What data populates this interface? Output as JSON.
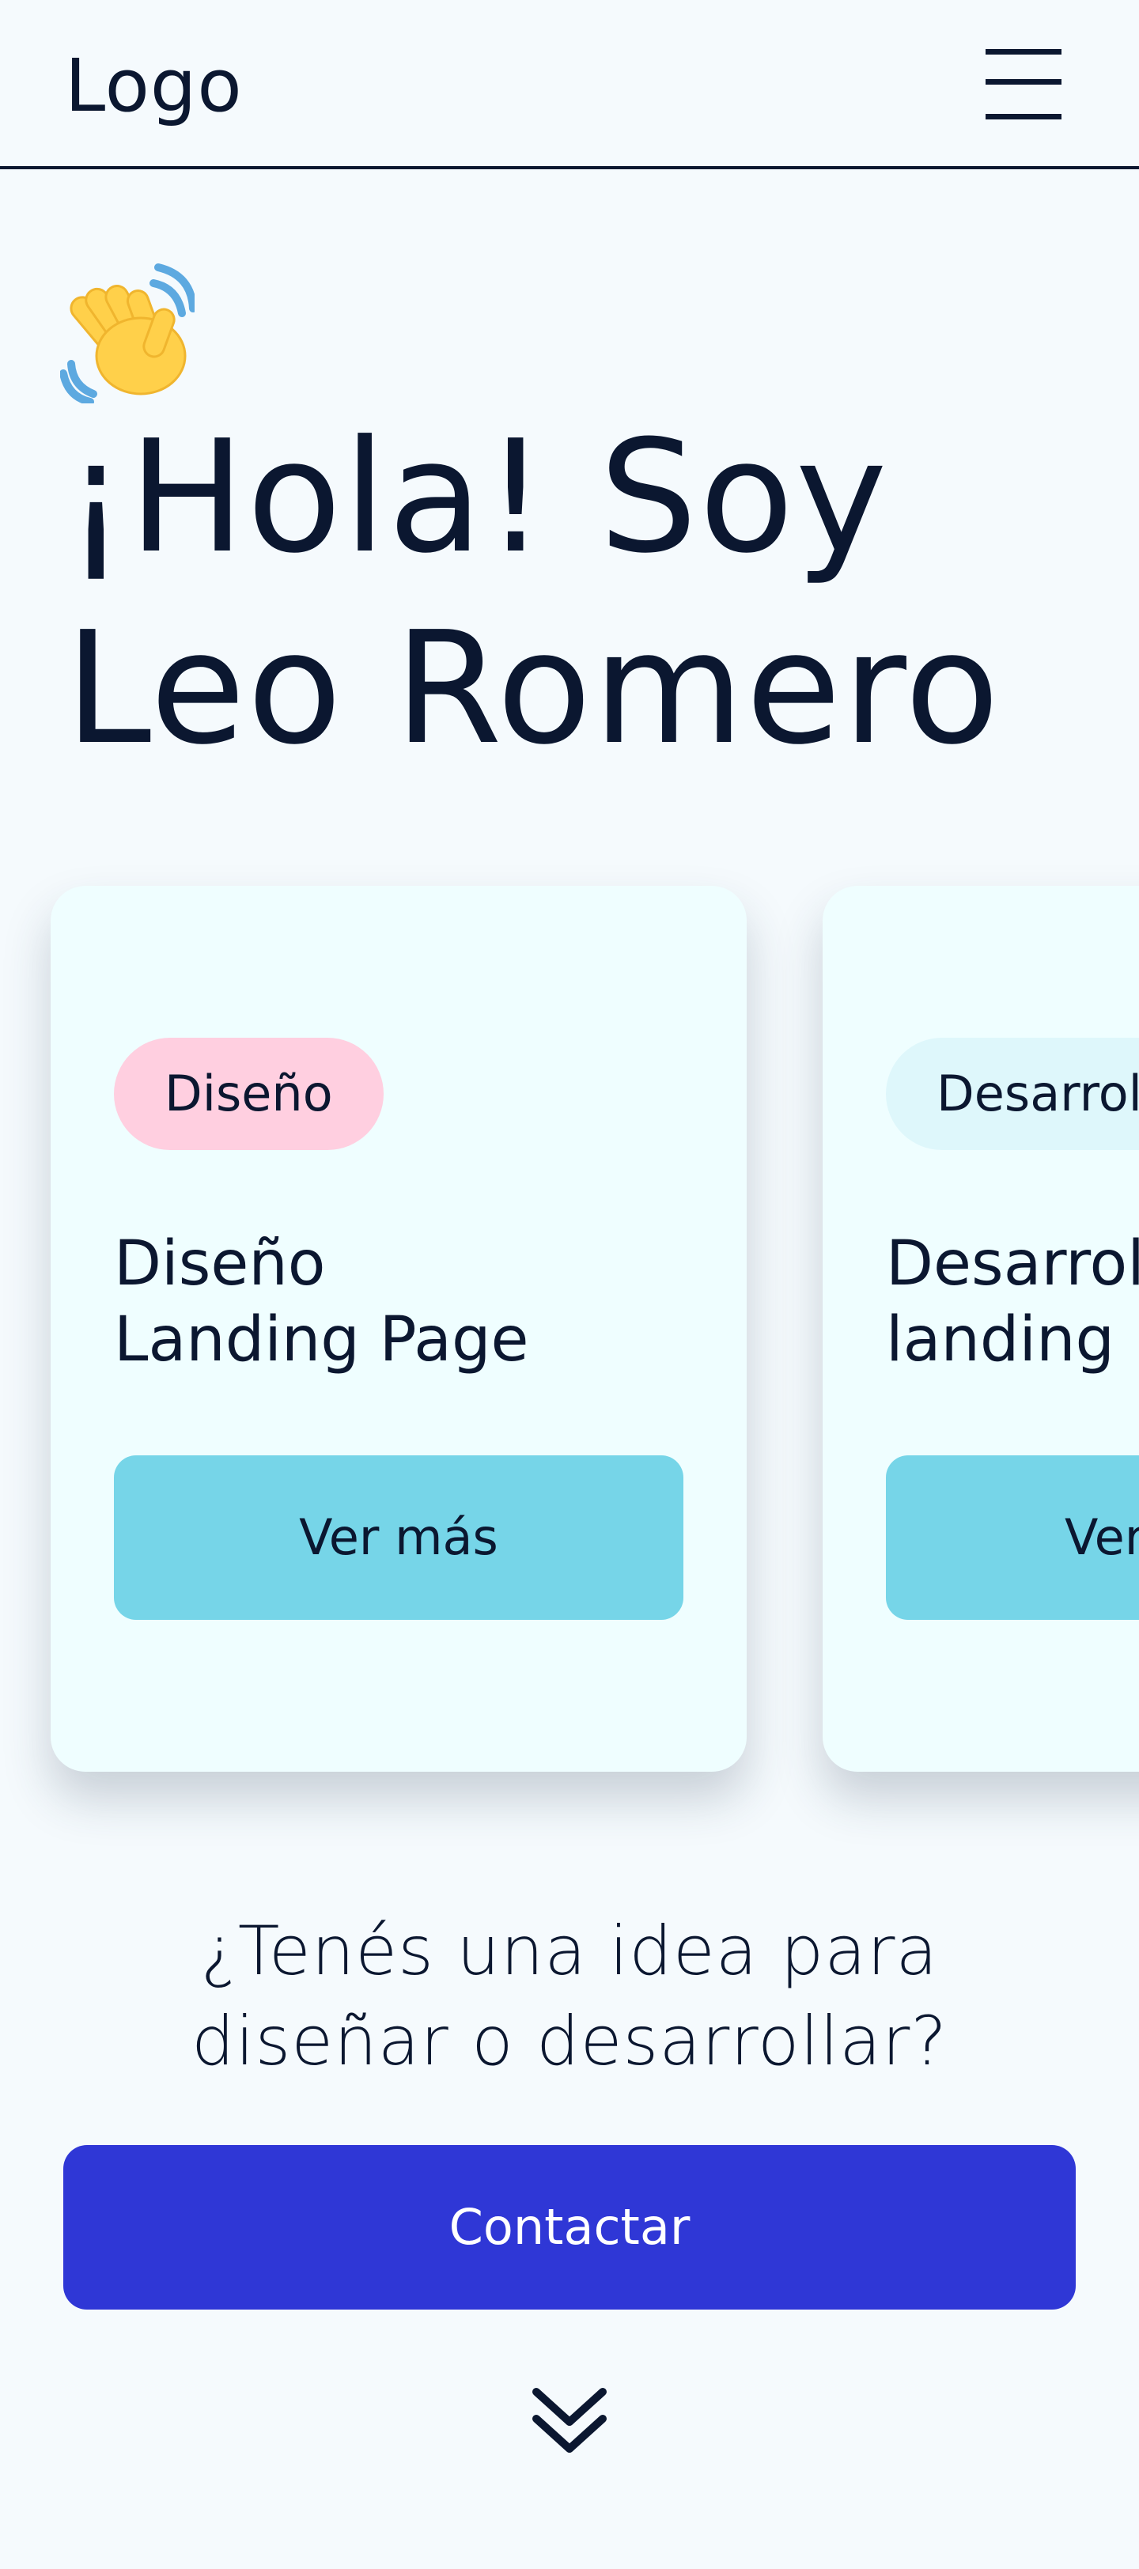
{
  "header": {
    "logo_text": "Logo",
    "menu_icon": "hamburger-menu-icon"
  },
  "hero": {
    "wave_icon": "waving-hand-icon",
    "title_line1": "¡Hola! Soy",
    "title_line2": "Leo Romero"
  },
  "cards": [
    {
      "tag": "Diseño",
      "tag_color": "#ffcfe0",
      "title_line1": "Diseño",
      "title_line2": "Landing Page",
      "button_label": "Ver más"
    },
    {
      "tag": "Desarrollo",
      "tag_color": "#def7fb",
      "title_line1": "Desarrollo",
      "title_line2": "landing page",
      "button_label": "Ver más"
    }
  ],
  "cta": {
    "line1": "¿Tenés una idea para",
    "line2": "diseñar o desarrollar?",
    "button_label": "Contactar"
  },
  "scroll_icon": "double-chevron-down-icon",
  "colors": {
    "background": "#f5fafd",
    "text": "#0b1730",
    "card_bg": "#effeff",
    "card_button": "#76d5e8",
    "primary_button": "#2f37d6"
  }
}
